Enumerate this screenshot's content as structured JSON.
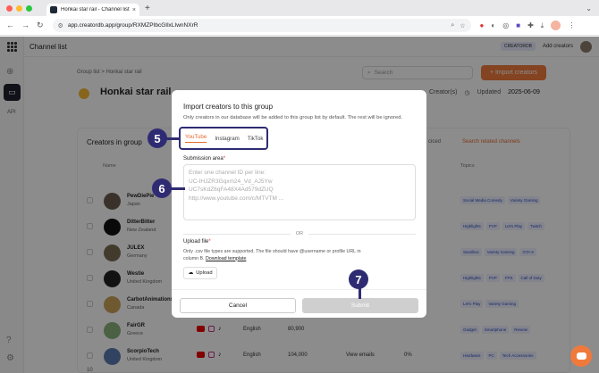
{
  "browser": {
    "tab_title": "Honkai star rail - Channel list",
    "url": "app.creatordb.app/group/RXMZPIbcGIlxLIwnNXrR"
  },
  "topbar": {
    "title": "Channel list",
    "badge": "CREATORDB",
    "add_creators": "Add creators"
  },
  "sidebar": {
    "api_label": "API"
  },
  "page": {
    "breadcrumb": "Group list  >  Honkai star rail",
    "search_placeholder": "Search",
    "import_button": "+ Import creators",
    "group_title": "Honkai star rail",
    "creators_count_label": "Creator(s)",
    "updated_label": "Updated",
    "updated_date": "2025-06-09"
  },
  "panel": {
    "title": "Creators in group",
    "link_sidebar": "ciced",
    "link_search": "Search related channels",
    "col_name": "Name",
    "col_topics": "Topics",
    "pager": "10"
  },
  "rows": [
    {
      "name": "PewDiePie",
      "country": "Japan",
      "color": "#6b5b4e",
      "tags": [
        "Social Media Comedy",
        "Variety Gaming"
      ]
    },
    {
      "name": "DitterBitter",
      "country": "New Zealand",
      "color": "#111",
      "tags": [
        "Highlights",
        "PVP",
        "Let's Play",
        "Twitch"
      ]
    },
    {
      "name": "JULEX",
      "country": "Germany",
      "color": "#7a6a55",
      "tags": [
        "Sandbox",
        "Variety Gaming",
        "GTA 5"
      ]
    },
    {
      "name": "Westie",
      "country": "United Kingdom",
      "color": "#222",
      "tags": [
        "Highlights",
        "PVP",
        "FPS",
        "Call of Duty"
      ]
    },
    {
      "name": "CarbotAnimations",
      "country": "Canada",
      "color": "#c9a35a",
      "tags": [
        "Let's Play",
        "Variety Gaming"
      ]
    },
    {
      "name": "FairGR",
      "country": "Greece",
      "color": "#8ab07a",
      "lang": "English",
      "subs": "80,900",
      "tags": [
        "Gadget",
        "Smartphone",
        "Review"
      ]
    },
    {
      "name": "ScorpioTech",
      "country": "United Kingdom",
      "color": "#5a7ab0",
      "lang": "English",
      "subs": "104,000",
      "view_emails": "View emails",
      "pct": "0%",
      "tags": [
        "Hardware",
        "PC",
        "Tech Accessories"
      ]
    }
  ],
  "modal": {
    "title": "Import creators to this group",
    "subtitle": "Only creators in our database will be added to this group list by default. The rest will be ignored.",
    "tabs": [
      "YouTube",
      "Instagram",
      "TikTok"
    ],
    "submission_label": "Submission area",
    "required_mark": "*",
    "textarea_placeholder": "Enter one channel ID per line:\nUC-IHJZR3Gqxm24_Vd_AJ5Yw\nUC7sKdZ6qFA48X4Ad579dZUQ\nhttp://www.youtube.com/c/MTVTM ...",
    "or_text": "OR",
    "upload_label": "Upload file",
    "upload_note": "Only .csv file types are supported. The file should have @username or profile URL in column B.",
    "download_template": "Download template",
    "upload_button": "Upload",
    "cancel_button": "Cancel",
    "submit_button": "Submit"
  },
  "callouts": {
    "five": "5",
    "six": "6",
    "seven": "7"
  },
  "colors": {
    "accent": "#f07a3c",
    "callout": "#2f2b73",
    "tab_active": "#e66a2e"
  }
}
